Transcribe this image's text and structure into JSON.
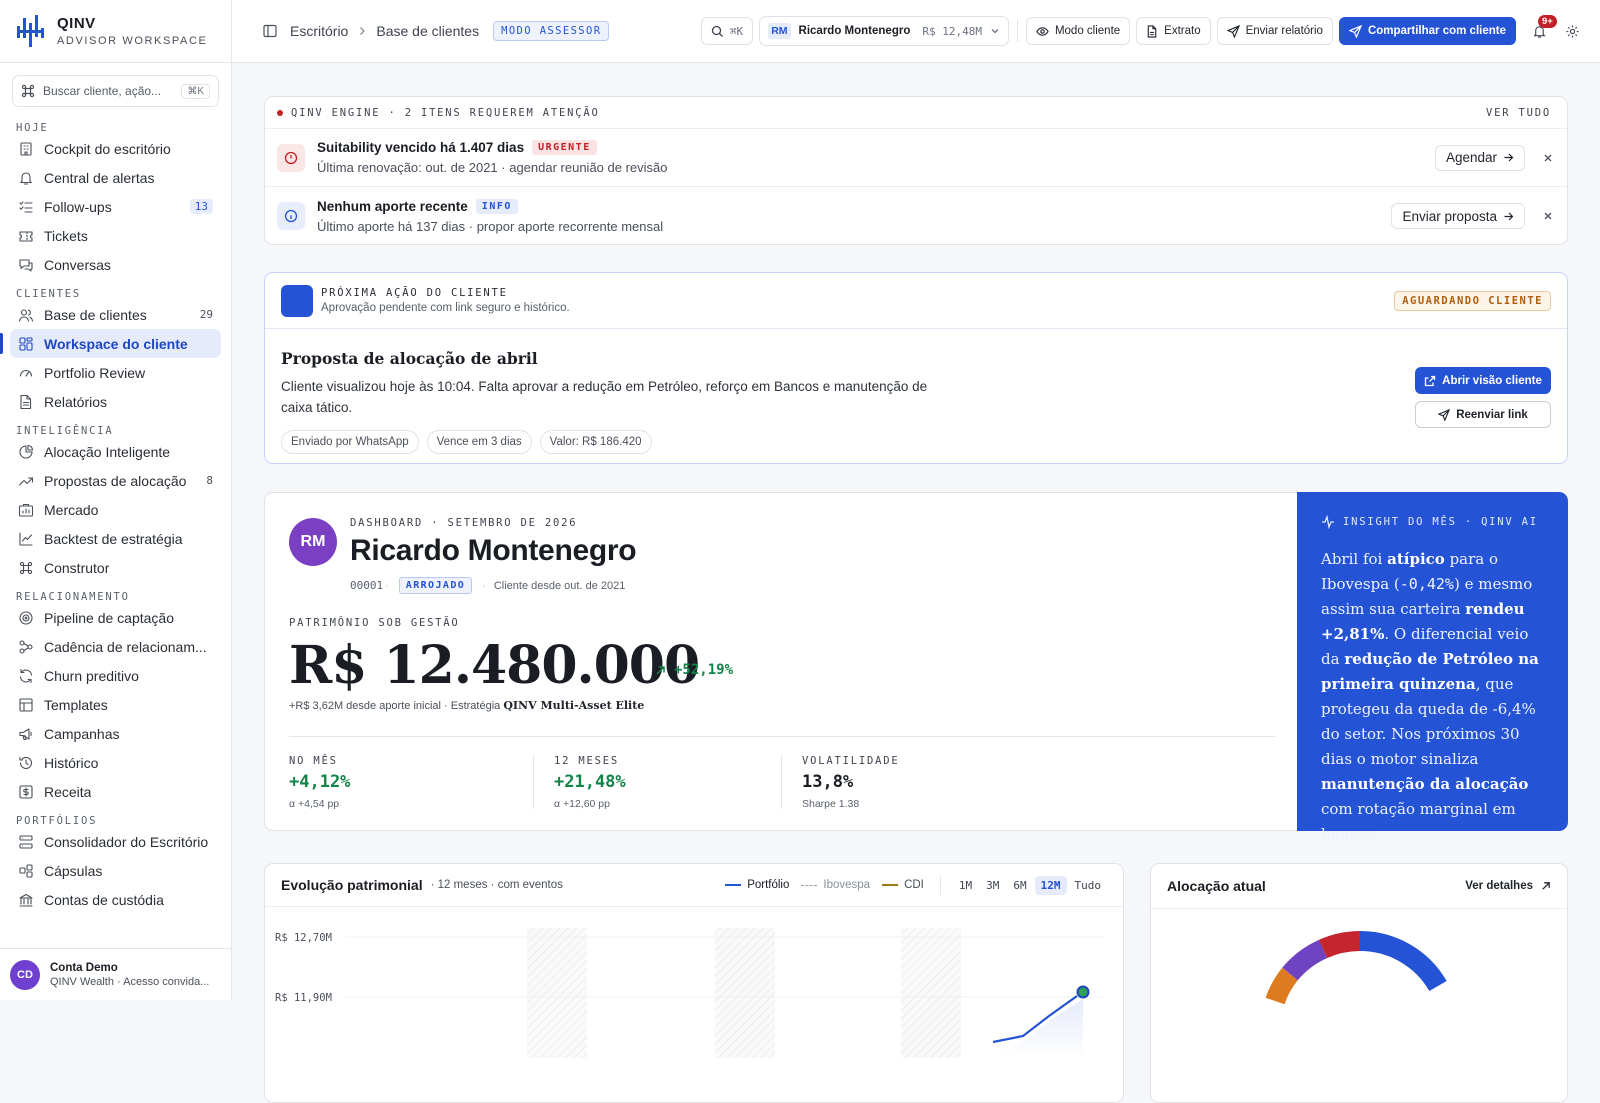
{
  "brand": {
    "name": "QINV",
    "sub": "ADVISOR WORKSPACE"
  },
  "sidebar": {
    "search_placeholder": "Buscar cliente, ação...",
    "search_kbd": "⌘K",
    "sections": [
      {
        "title": "HOJE",
        "items": [
          {
            "label": "Cockpit do escritório",
            "icon": "building-icon"
          },
          {
            "label": "Central de alertas",
            "icon": "bell-icon"
          },
          {
            "label": "Follow-ups",
            "icon": "checklist-icon",
            "count": "13",
            "pill": true
          },
          {
            "label": "Tickets",
            "icon": "ticket-icon"
          },
          {
            "label": "Conversas",
            "icon": "chat-icon"
          }
        ]
      },
      {
        "title": "CLIENTES",
        "items": [
          {
            "label": "Base de clientes",
            "icon": "users-icon",
            "count": "29"
          },
          {
            "label": "Workspace do cliente",
            "icon": "grid-icon",
            "active": true
          },
          {
            "label": "Portfolio Review",
            "icon": "gauge-icon"
          },
          {
            "label": "Relatórios",
            "icon": "file-icon"
          }
        ]
      },
      {
        "title": "INTELIGÊNCIA",
        "items": [
          {
            "label": "Alocação Inteligente",
            "icon": "pie-icon"
          },
          {
            "label": "Propostas de alocação",
            "icon": "trend-icon",
            "count": "8"
          },
          {
            "label": "Mercado",
            "icon": "market-icon"
          },
          {
            "label": "Backtest de estratégia",
            "icon": "chart-icon"
          },
          {
            "label": "Construtor",
            "icon": "command-icon"
          }
        ]
      },
      {
        "title": "RELACIONAMENTO",
        "items": [
          {
            "label": "Pipeline de captação",
            "icon": "target-icon"
          },
          {
            "label": "Cadência de relacionam...",
            "icon": "flow-icon"
          },
          {
            "label": "Churn preditivo",
            "icon": "refresh-icon"
          },
          {
            "label": "Templates",
            "icon": "template-icon"
          },
          {
            "label": "Campanhas",
            "icon": "megaphone-icon"
          },
          {
            "label": "Histórico",
            "icon": "history-icon"
          },
          {
            "label": "Receita",
            "icon": "dollar-icon"
          }
        ]
      },
      {
        "title": "PORTFÓLIOS",
        "items": [
          {
            "label": "Consolidador do Escritório",
            "icon": "layers-icon"
          },
          {
            "label": "Cápsulas",
            "icon": "capsule-icon"
          },
          {
            "label": "Contas de custódia",
            "icon": "bank-icon"
          }
        ]
      }
    ],
    "user": {
      "initials": "CD",
      "name": "Conta Demo",
      "sub": "QINV Wealth · Acesso convida..."
    }
  },
  "topbar": {
    "breadcrumb": [
      "Escritório",
      "Base de clientes"
    ],
    "mode_badge": "MODO ASSESSOR",
    "search_kbd": "⌘K",
    "client": {
      "initials": "RM",
      "name": "Ricardo Montenegro",
      "value": "R$ 12,48M"
    },
    "buttons": {
      "client_mode": "Modo cliente",
      "statement": "Extrato",
      "send_report": "Enviar relatório",
      "share": "Compartilhar com cliente"
    },
    "notifications": "9+"
  },
  "engine": {
    "title": "QINV ENGINE · 2 ITENS REQUEREM ATENÇÃO",
    "see_all": "VER TUDO",
    "alerts": [
      {
        "title": "Suitability vencido há 1.407 dias",
        "tag": "URGENTE",
        "sub": "Última renovação: out. de 2021 · agendar reunião de revisão",
        "action": "Agendar"
      },
      {
        "title": "Nenhum aporte recente",
        "tag": "INFO",
        "sub": "Último aporte há 137 dias · propor aporte recorrente mensal",
        "action": "Enviar proposta"
      }
    ]
  },
  "next_action": {
    "kicker": "PRÓXIMA AÇÃO DO CLIENTE",
    "kicker_sub": "Aprovação pendente com link seguro e histórico.",
    "status": "AGUARDANDO CLIENTE",
    "title": "Proposta de alocação de abril",
    "body": "Cliente visualizou hoje às 10:04. Falta aprovar a redução em Petróleo, reforço em Bancos e manutenção de caixa tático.",
    "chips": [
      "Enviado por WhatsApp",
      "Vence em 3 dias",
      "Valor: R$ 186.420"
    ],
    "open_btn": "Abrir visão cliente",
    "resend_btn": "Reenviar link"
  },
  "dashboard": {
    "initials": "RM",
    "kicker": "DASHBOARD · SETEMBRO DE 2026",
    "name": "Ricardo Montenegro",
    "code": "00001",
    "profile": "ARROJADO",
    "since": "Cliente desde out. de 2021",
    "aum_label": "PATRIMÔNIO SOB GESTÃO",
    "aum_value": "R$ 12.480.000",
    "aum_change": "+52,19%",
    "aum_sub": "+R$ 3,62M desde aporte inicial · Estratégia",
    "strategy": "QINV Multi-Asset Elite",
    "kpis": [
      {
        "label": "NO MÊS",
        "value": "+4,12%",
        "sub": "α +4,54 pp",
        "green": true
      },
      {
        "label": "12 MESES",
        "value": "+21,48%",
        "sub": "α +12,60 pp",
        "green": true
      },
      {
        "label": "VOLATILIDADE",
        "value": "13,8%",
        "sub": "Sharpe 1.38",
        "green": false
      }
    ]
  },
  "insight": {
    "kicker": "INSIGHT DO MÊS · QINV AI",
    "parts": [
      {
        "t": "Abril foi "
      },
      {
        "t": "atípico",
        "b": true
      },
      {
        "t": " para o Ibovespa ("
      },
      {
        "t": "-0,42%",
        "m": true
      },
      {
        "t": ") e mesmo assim sua carteira "
      },
      {
        "t": "rendeu +2,81%",
        "b": true
      },
      {
        "t": ". O diferencial veio da "
      },
      {
        "t": "redução de Petróleo na primeira quinzena",
        "b": true
      },
      {
        "t": ", que protegeu da queda de -6,4% do setor. Nos próximos 30 dias o motor sinaliza "
      },
      {
        "t": "manutenção da alocação",
        "b": true
      },
      {
        "t": " com rotação marginal em bancos."
      }
    ]
  },
  "evolution": {
    "title": "Evolução patrimonial",
    "sub": "· 12 meses · com eventos",
    "legend": {
      "portfolio": "Portfólio",
      "ibov": "Ibovespa",
      "cdi": "CDI"
    },
    "ranges": [
      "1M",
      "3M",
      "6M",
      "12M",
      "Tudo"
    ],
    "active_range": "12M",
    "y_ticks": [
      "R$ 12,70M",
      "R$ 11,90M"
    ]
  },
  "allocation": {
    "title": "Alocação atual",
    "link": "Ver detalhes"
  },
  "colors": {
    "accent": "#2453d6",
    "green": "#138447",
    "red": "#c22027",
    "ibov": "#9aa0aa",
    "cdi": "#a07a12"
  }
}
